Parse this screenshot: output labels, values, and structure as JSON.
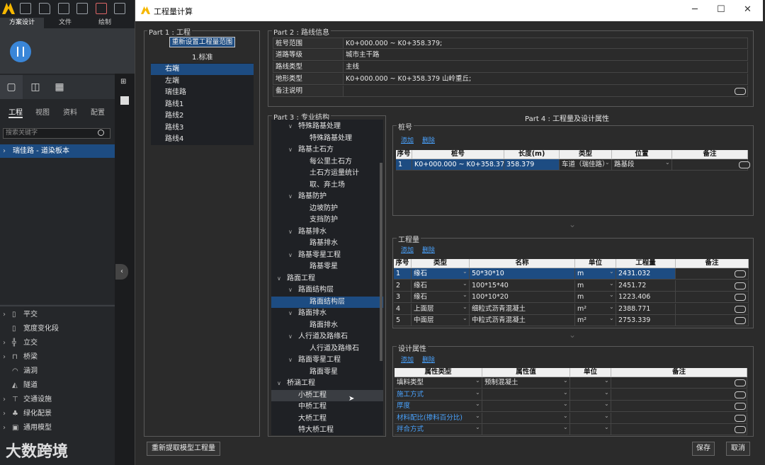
{
  "app": {
    "ribbon_tabs": [
      "方案设计",
      "文件",
      "绘制"
    ],
    "side_tabs": [
      "工程",
      "视图",
      "资料",
      "配置"
    ],
    "search_placeholder": "搜索关键字",
    "project_item": "瑞佳路 - 道染板本",
    "bottom_items": [
      "平交",
      "宽度变化段",
      "立交",
      "桥梁",
      "涵洞",
      "隧道",
      "交通设施",
      "绿化配景",
      "通用模型"
    ],
    "watermark": "大数跨境"
  },
  "dialog": {
    "title": "工程量计算",
    "part1": {
      "title": "Part 1 : 工程",
      "reset_button": "重新设置工程量范围",
      "standard": "1.标准",
      "items": [
        "右端",
        "左端",
        "瑞佳路",
        "路线1",
        "路线2",
        "路线3",
        "路线4"
      ],
      "selected": 0,
      "reextract_button": "重新提取模型工程量"
    },
    "part2": {
      "title": "Part 2 : 路线信息",
      "rows": [
        {
          "label": "桩号范围",
          "value": "K0+000.000 ~ K0+358.379;"
        },
        {
          "label": "道路等级",
          "value": "城市主干路"
        },
        {
          "label": "路线类型",
          "value": "主线"
        },
        {
          "label": "地形类型",
          "value": "K0+000.000 ~ K0+358.379 山岭重丘;"
        },
        {
          "label": "备注说明",
          "value": ""
        }
      ]
    },
    "part3": {
      "title": "Part 3 : 专业结构",
      "tree": [
        {
          "label": "特殊路基处理",
          "level": 1,
          "chev": "∨"
        },
        {
          "label": "特殊路基处理",
          "level": 2,
          "chev": ""
        },
        {
          "label": "路基土石方",
          "level": 1,
          "chev": "∨"
        },
        {
          "label": "每公里土石方",
          "level": 2,
          "chev": ""
        },
        {
          "label": "土石方运量统计",
          "level": 2,
          "chev": ""
        },
        {
          "label": "取、弃土场",
          "level": 2,
          "chev": ""
        },
        {
          "label": "路基防护",
          "level": 1,
          "chev": "∨"
        },
        {
          "label": "边坡防护",
          "level": 2,
          "chev": ""
        },
        {
          "label": "支挡防护",
          "level": 2,
          "chev": ""
        },
        {
          "label": "路基排水",
          "level": 1,
          "chev": "∨"
        },
        {
          "label": "路基排水",
          "level": 2,
          "chev": ""
        },
        {
          "label": "路基零星工程",
          "level": 1,
          "chev": "∨"
        },
        {
          "label": "路基零星",
          "level": 2,
          "chev": ""
        },
        {
          "label": "路面工程",
          "level": 0,
          "chev": "∨"
        },
        {
          "label": "路面结构层",
          "level": 1,
          "chev": "∨"
        },
        {
          "label": "路面结构层",
          "level": 2,
          "chev": "",
          "selected": true
        },
        {
          "label": "路面排水",
          "level": 1,
          "chev": "∨"
        },
        {
          "label": "路面排水",
          "level": 2,
          "chev": ""
        },
        {
          "label": "人行道及路缘石",
          "level": 1,
          "chev": "∨"
        },
        {
          "label": "人行道及路缘石",
          "level": 2,
          "chev": ""
        },
        {
          "label": "路面零星工程",
          "level": 1,
          "chev": "∨"
        },
        {
          "label": "路面零星",
          "level": 2,
          "chev": ""
        },
        {
          "label": "桥涵工程",
          "level": 0,
          "chev": "∨"
        },
        {
          "label": "小桥工程",
          "level": 1,
          "chev": "",
          "hover": true
        },
        {
          "label": "中桥工程",
          "level": 1,
          "chev": ""
        },
        {
          "label": "大桥工程",
          "level": 1,
          "chev": ""
        },
        {
          "label": "特大桥工程",
          "level": 1,
          "chev": ""
        }
      ]
    },
    "part4": {
      "title": "Part 4 : 工程量及设计属性",
      "add": "添加",
      "delete": "删除",
      "station": {
        "title": "桩号",
        "headers": [
          "序号",
          "桩号",
          "长度(m)",
          "类型",
          "位置",
          "备注"
        ],
        "rows": [
          {
            "no": "1",
            "station": "K0+000.000 ~ K0+358.379",
            "length": "358.379",
            "type": "车道（瑞佳路）",
            "position": "路基段",
            "note": ""
          }
        ]
      },
      "quantity": {
        "title": "工程量",
        "headers": [
          "序号",
          "类型",
          "名称",
          "单位",
          "工程量",
          "备注"
        ],
        "rows": [
          {
            "no": "1",
            "type": "缘石",
            "name": "50*30*10",
            "unit": "m",
            "qty": "2431.032"
          },
          {
            "no": "2",
            "type": "缘石",
            "name": "100*15*40",
            "unit": "m",
            "qty": "2451.72"
          },
          {
            "no": "3",
            "type": "缘石",
            "name": "100*10*20",
            "unit": "m",
            "qty": "1223.406"
          },
          {
            "no": "4",
            "type": "上面层",
            "name": "细粒式沥青混凝土",
            "unit": "m²",
            "qty": "2388.771"
          },
          {
            "no": "5",
            "type": "中面层",
            "name": "中粒式沥青混凝土",
            "unit": "m²",
            "qty": "2753.339"
          }
        ]
      },
      "design": {
        "title": "设计属性",
        "headers": [
          "属性类型",
          "属性值",
          "单位",
          "备注"
        ],
        "rows": [
          {
            "attr": "填料类型",
            "value": "预制混凝土",
            "unit": "",
            "link": false
          },
          {
            "attr": "施工方式",
            "value": "",
            "unit": "",
            "link": true
          },
          {
            "attr": "厚度",
            "value": "",
            "unit": "",
            "link": true
          },
          {
            "attr": "材料配比(掺料百分比)",
            "value": "",
            "unit": "",
            "link": true
          },
          {
            "attr": "拌合方式",
            "value": "",
            "unit": "",
            "link": true
          }
        ]
      }
    },
    "buttons": {
      "save": "保存",
      "cancel": "取消"
    }
  }
}
